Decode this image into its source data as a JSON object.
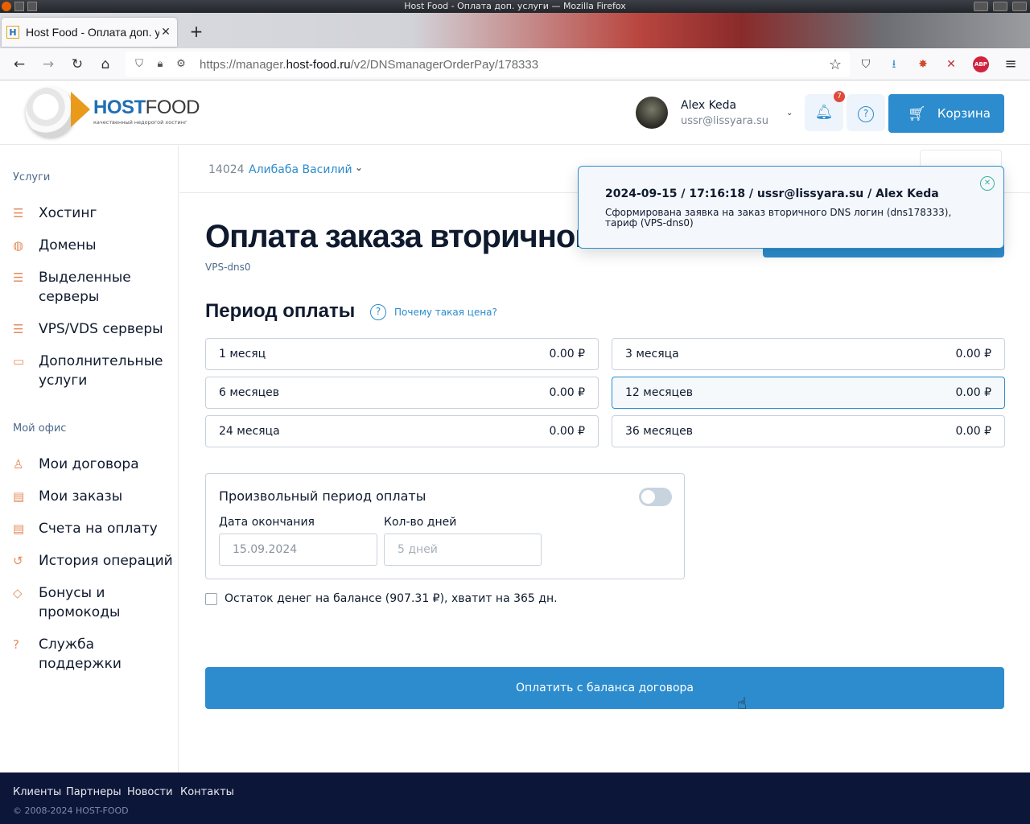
{
  "browser": {
    "window_title": "Host Food - Оплата доп. услуги — Mozilla Firefox",
    "tab_title": "Host Food - Оплата доп. ус",
    "url_prefix": "https://manager.",
    "url_domain": "host-food.ru",
    "url_path": "/v2/DNSmanagerOrderPay/178333"
  },
  "header": {
    "logo_host": "HOST",
    "logo_food": "FOOD",
    "logo_tagline": "качественный недорогой хостинг",
    "user_name": "Alex Keda",
    "user_email": "ussr@lissyara.su",
    "notifications_count": "7",
    "cart_label": "Корзина"
  },
  "sidebar": {
    "section_services": "Услуги",
    "services": [
      {
        "label": "Хостинг",
        "icon": "server-stack-icon"
      },
      {
        "label": "Домены",
        "icon": "globe-icon"
      },
      {
        "label": "Выделенные серверы",
        "icon": "server-icon"
      },
      {
        "label": "VPS/VDS серверы",
        "icon": "vps-icon"
      },
      {
        "label": "Дополнительные услуги",
        "icon": "window-icon"
      }
    ],
    "section_office": "Мой офис",
    "office": [
      {
        "label": "Мои договора",
        "icon": "user-icon"
      },
      {
        "label": "Мои заказы",
        "icon": "orders-icon"
      },
      {
        "label": "Счета на оплату",
        "icon": "invoice-icon"
      },
      {
        "label": "История операций",
        "icon": "history-icon"
      },
      {
        "label": "Бонусы и промокоды",
        "icon": "tag-icon"
      },
      {
        "label": "Служба поддержки",
        "icon": "support-icon"
      }
    ]
  },
  "contract": {
    "id": "14024",
    "name": "Алибаба Василий"
  },
  "page": {
    "title": "Оплата заказа вторичного DNS",
    "subtitle": "VPS-dns0",
    "period_heading": "Период оплаты",
    "why_price": "Почему такая цена?",
    "periods": [
      {
        "label": "1 месяц",
        "price": "0.00 ₽",
        "selected": false
      },
      {
        "label": "3 месяца",
        "price": "0.00 ₽",
        "selected": false
      },
      {
        "label": "6 месяцев",
        "price": "0.00 ₽",
        "selected": false
      },
      {
        "label": "12 месяцев",
        "price": "0.00 ₽",
        "selected": true
      },
      {
        "label": "24 месяца",
        "price": "0.00 ₽",
        "selected": false
      },
      {
        "label": "36 месяцев",
        "price": "0.00 ₽",
        "selected": false
      }
    ],
    "custom_period_title": "Произвольный период оплаты",
    "custom_period_enabled": false,
    "end_date_label": "Дата окончания",
    "end_date_value": "15.09.2024",
    "days_label": "Кол-во дней",
    "days_placeholder": "5 дней",
    "balance_text": "Остаток денег на балансе (907.31 ₽), хватит на 365 дн.",
    "pay_button": "Оплатить с баланса договора"
  },
  "notification": {
    "header": "2024-09-15 / 17:16:18 / ussr@lissyara.su / Alex Keda",
    "message": "Сформирована заявка на заказ вторичного DNS логин (dns178333), тариф (VPS-dns0)"
  },
  "footer": {
    "links": [
      "Клиенты",
      "Партнеры",
      "Новости",
      "Контакты"
    ],
    "copyright": "© 2008-2024 HOST-FOOD"
  },
  "colors": {
    "accent": "#2c8ccd",
    "footer_bg": "#0b1638",
    "badge": "#e04a3a"
  }
}
